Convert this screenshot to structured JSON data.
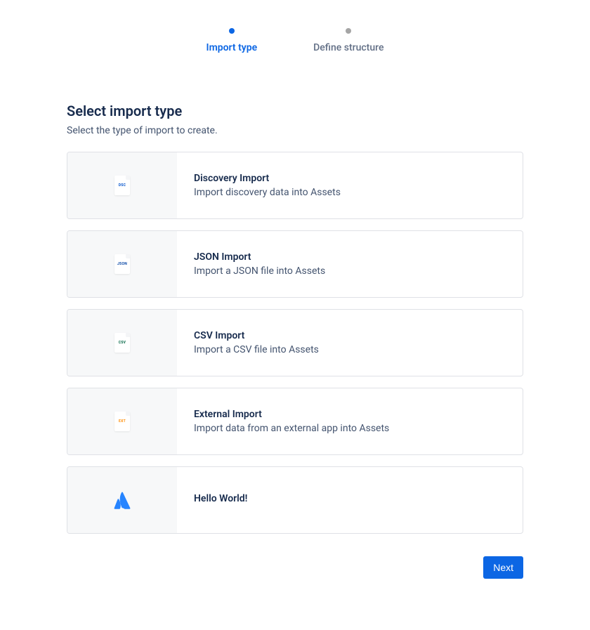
{
  "stepper": {
    "steps": [
      {
        "label": "Import type",
        "active": true
      },
      {
        "label": "Define structure",
        "active": false
      }
    ]
  },
  "page": {
    "title": "Select import type",
    "subtitle": "Select the type of import to create."
  },
  "options": [
    {
      "icon": "DSC",
      "iconClass": "file-dsc",
      "title": "Discovery Import",
      "description": "Import discovery data into Assets"
    },
    {
      "icon": "JSON",
      "iconClass": "file-json",
      "title": "JSON Import",
      "description": "Import a JSON file into Assets"
    },
    {
      "icon": "CSV",
      "iconClass": "file-csv",
      "title": "CSV Import",
      "description": "Import a CSV file into Assets"
    },
    {
      "icon": "EXT",
      "iconClass": "file-ext",
      "title": "External Import",
      "description": "Import data from an external app into Assets"
    },
    {
      "icon": "atlassian",
      "iconClass": "atlassian",
      "title": "Hello World!",
      "description": ""
    }
  ],
  "footer": {
    "next_label": "Next"
  }
}
